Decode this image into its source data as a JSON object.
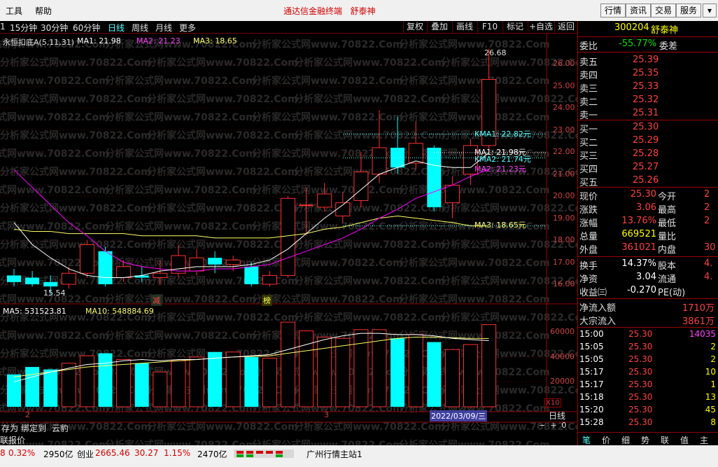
{
  "menu": {
    "tools": "工具",
    "help": "帮助",
    "center_title": "通达信金融终端",
    "center_stock": "舒泰神",
    "right_buttons": [
      "行情",
      "资讯",
      "交易",
      "服务"
    ]
  },
  "toolbar": {
    "periods": [
      "1",
      "15分钟",
      "30分钟",
      "60分钟",
      "日线",
      "周线",
      "月线",
      "更多"
    ],
    "selected": "日线",
    "right_buttons": [
      "复权",
      "叠加",
      "画线",
      "F10",
      "标记",
      "+自选",
      "返回"
    ]
  },
  "indicator": {
    "name": "永恒扣底A(5,11,31)",
    "ma1": "MA1: 21.98",
    "ma2": "MA2: 21.23",
    "ma3": "MA3: 18.65"
  },
  "watermark": "分析家公式网www.70822.Com",
  "price_axis": [
    "26.00",
    "25.00",
    "24.00",
    "23.00",
    "22.00",
    "21.00",
    "20.00",
    "19.00",
    "18.00",
    "17.00",
    "16.00"
  ],
  "price_labels": {
    "high": "26.68",
    "low": "15.54",
    "kma1": "KMA1: 22.82元",
    "kma2": "KMA2: 21.74元",
    "ma1": "MA1: 21.98元",
    "ma2": "MA2: 21.23元",
    "ma3": "MA3: 18.65元"
  },
  "signals": {
    "jian": "减",
    "bang": "榜"
  },
  "volume": {
    "ma5": "MA5: 531523.81",
    "ma10": "MA10: 548884.69",
    "axis": [
      "60000",
      "40000",
      "20000"
    ],
    "unit": "X10",
    "date_label": "2022/03/09/三",
    "period_label": "日线",
    "x_labels": [
      "2",
      "3"
    ]
  },
  "bottom_tabs": [
    "存为",
    "绑定到",
    "云豹"
  ],
  "bottom_label": "联报价",
  "stock": {
    "code": "300204",
    "name": "舒泰神",
    "weibi_label": "委比",
    "weibi": "-55.77%",
    "weicha_label": "委差"
  },
  "asks": [
    {
      "label": "卖五",
      "price": "25.39"
    },
    {
      "label": "卖四",
      "price": "25.35"
    },
    {
      "label": "卖三",
      "price": "25.33"
    },
    {
      "label": "卖二",
      "price": "25.32"
    },
    {
      "label": "卖一",
      "price": "25.31"
    }
  ],
  "bids": [
    {
      "label": "买一",
      "price": "25.30"
    },
    {
      "label": "买二",
      "price": "25.29"
    },
    {
      "label": "买三",
      "price": "25.28"
    },
    {
      "label": "买四",
      "price": "25.27"
    },
    {
      "label": "买五",
      "price": "25.26"
    }
  ],
  "quote": [
    {
      "k1": "现价",
      "v1": "25.30",
      "k2": "今开",
      "v2": "2"
    },
    {
      "k1": "涨跌",
      "v1": "3.06",
      "k2": "最高",
      "v2": "2"
    },
    {
      "k1": "涨幅",
      "v1": "13.76%",
      "k2": "最低",
      "v2": "2"
    },
    {
      "k1": "总量",
      "v1": "669521",
      "k2": "量比",
      "v2": ""
    },
    {
      "k1": "外盘",
      "v1": "361021",
      "k2": "内盘",
      "v2": "30"
    }
  ],
  "fund": [
    {
      "k1": "换手",
      "v1": "14.37%",
      "k2": "股本",
      "v2": "4."
    },
    {
      "k1": "净资",
      "v1": "3.04",
      "k2": "流通",
      "v2": "4."
    },
    {
      "k1": "收益㈢",
      "v1": "-0.270",
      "k2": "PE(动)",
      "v2": ""
    }
  ],
  "flow": [
    {
      "label": "净流入额",
      "value": "1710万"
    },
    {
      "label": "大宗流入",
      "value": "3861万"
    }
  ],
  "ticks": [
    {
      "time": "15:00",
      "price": "25.30",
      "vol": "14035"
    },
    {
      "time": "15:05",
      "price": "25.30",
      "vol": "2"
    },
    {
      "time": "15:05",
      "price": "25.30",
      "vol": "2"
    },
    {
      "time": "15:17",
      "price": "25.30",
      "vol": "10"
    },
    {
      "time": "15:17",
      "price": "25.30",
      "vol": "1"
    },
    {
      "time": "15:18",
      "price": "25.30",
      "vol": "13"
    },
    {
      "time": "15:20",
      "price": "25.30",
      "vol": "45"
    },
    {
      "time": "15:28",
      "price": "25.30",
      "vol": "8"
    }
  ],
  "right_tabs": [
    "笔",
    "价",
    "细",
    "势",
    "联",
    "值",
    "主"
  ],
  "statusbar": {
    "idx1_pct": "0.32%",
    "idx1_amt": "2950亿",
    "cy_label": "创业",
    "cy_val": "2665.46",
    "cy_chg": "30.27",
    "cy_pct": "1.15%",
    "cy_amt": "2470亿",
    "server": "广州行情主站1",
    "lead": "8"
  },
  "colors": {
    "up": "#ff3030",
    "down": "#00ffff",
    "ma_white": "#ffffff",
    "ma_magenta": "#ff00ff",
    "ma_yellow": "#ffff66"
  },
  "chart_data": {
    "type": "candlestick",
    "candles": [
      {
        "o": 16.4,
        "c": 16.1,
        "h": 16.7,
        "l": 15.9
      },
      {
        "o": 16.3,
        "c": 16.0,
        "h": 16.6,
        "l": 15.9
      },
      {
        "o": 16.1,
        "c": 15.9,
        "h": 16.4,
        "l": 15.54
      },
      {
        "o": 16.0,
        "c": 16.5,
        "h": 16.8,
        "l": 15.8
      },
      {
        "o": 16.5,
        "c": 17.8,
        "h": 18.0,
        "l": 16.3
      },
      {
        "o": 17.5,
        "c": 16.0,
        "h": 17.7,
        "l": 15.9
      },
      {
        "o": 16.3,
        "c": 16.8,
        "h": 17.1,
        "l": 16.1
      },
      {
        "o": 16.4,
        "c": 16.3,
        "h": 16.8,
        "l": 16.1
      },
      {
        "o": 16.3,
        "c": 16.5,
        "h": 17.1,
        "l": 16.0
      },
      {
        "o": 16.5,
        "c": 17.3,
        "h": 17.8,
        "l": 16.3
      },
      {
        "o": 16.6,
        "c": 17.2,
        "h": 17.6,
        "l": 16.4
      },
      {
        "o": 17.2,
        "c": 16.9,
        "h": 17.5,
        "l": 16.5
      },
      {
        "o": 16.9,
        "c": 17.1,
        "h": 17.3,
        "l": 16.6
      },
      {
        "o": 16.8,
        "c": 16.0,
        "h": 17.0,
        "l": 15.9
      },
      {
        "o": 16.0,
        "c": 16.4,
        "h": 16.6,
        "l": 15.9
      },
      {
        "o": 16.4,
        "c": 19.9,
        "h": 20.0,
        "l": 16.3
      },
      {
        "o": 19.6,
        "c": 19.6,
        "h": 20.4,
        "l": 18.2
      },
      {
        "o": 19.5,
        "c": 20.1,
        "h": 20.6,
        "l": 19.3
      },
      {
        "o": 19.1,
        "c": 19.7,
        "h": 20.2,
        "l": 18.8
      },
      {
        "o": 19.8,
        "c": 21.1,
        "h": 22.0,
        "l": 19.5
      },
      {
        "o": 21.0,
        "c": 22.2,
        "h": 23.9,
        "l": 20.6
      },
      {
        "o": 22.2,
        "c": 21.3,
        "h": 23.6,
        "l": 21.0
      },
      {
        "o": 21.5,
        "c": 22.4,
        "h": 23.4,
        "l": 21.2
      },
      {
        "o": 22.2,
        "c": 19.5,
        "h": 22.3,
        "l": 19.3
      },
      {
        "o": 19.7,
        "c": 20.5,
        "h": 20.9,
        "l": 19.0
      },
      {
        "o": 21.0,
        "c": 22.3,
        "h": 22.6,
        "l": 20.5
      },
      {
        "o": 22.3,
        "c": 25.3,
        "h": 26.68,
        "l": 22.0
      }
    ],
    "volumes": [
      26000,
      32000,
      30000,
      35000,
      41000,
      43000,
      38000,
      35000,
      28000,
      37000,
      40000,
      44000,
      44000,
      40000,
      39000,
      68000,
      61000,
      56000,
      55000,
      62000,
      62000,
      55000,
      58000,
      52000,
      46000,
      50000,
      66000
    ],
    "ma1": [
      18.8,
      17.8,
      17.2,
      16.7,
      16.4,
      16.3,
      16.3,
      16.4,
      16.6,
      16.7,
      16.8,
      16.8,
      16.8,
      16.9,
      17.1,
      17.6,
      18.3,
      19.0,
      19.6,
      20.3,
      21.0,
      21.3,
      21.6,
      21.4,
      21.3,
      21.3,
      21.98
    ],
    "ma2": [
      21.2,
      20.4,
      19.6,
      18.8,
      18.2,
      17.5,
      17.0,
      16.8,
      16.7,
      16.6,
      16.6,
      16.7,
      16.7,
      16.8,
      16.9,
      17.2,
      17.5,
      17.8,
      18.1,
      18.5,
      19.0,
      19.4,
      19.9,
      20.2,
      20.5,
      20.9,
      21.23
    ],
    "ma3": [
      18.5,
      18.4,
      18.4,
      18.3,
      18.3,
      18.3,
      18.3,
      18.2,
      18.2,
      18.2,
      18.2,
      18.1,
      18.1,
      18.1,
      18.1,
      18.2,
      18.3,
      18.5,
      18.6,
      18.8,
      19.0,
      19.1,
      19.0,
      18.9,
      18.8,
      18.65,
      18.65
    ],
    "vol_ma5": [
      20000,
      24000,
      28000,
      31000,
      34000,
      35000,
      37000,
      38000,
      37000,
      38000,
      38000,
      39000,
      40000,
      41000,
      42000,
      46000,
      50000,
      54000,
      57000,
      59000,
      59000,
      58000,
      58000,
      57000,
      55000,
      54000,
      53152
    ],
    "vol_ma10": [
      24000,
      26000,
      28000,
      30000,
      32000,
      33000,
      34000,
      35000,
      36000,
      37000,
      38000,
      39000,
      40000,
      40500,
      41000,
      43000,
      45000,
      47000,
      49000,
      51000,
      53000,
      55000,
      56000,
      56000,
      55500,
      55000,
      54888
    ],
    "ylim": [
      15.3,
      27.0
    ],
    "vol_ylim": [
      0,
      72000
    ]
  }
}
